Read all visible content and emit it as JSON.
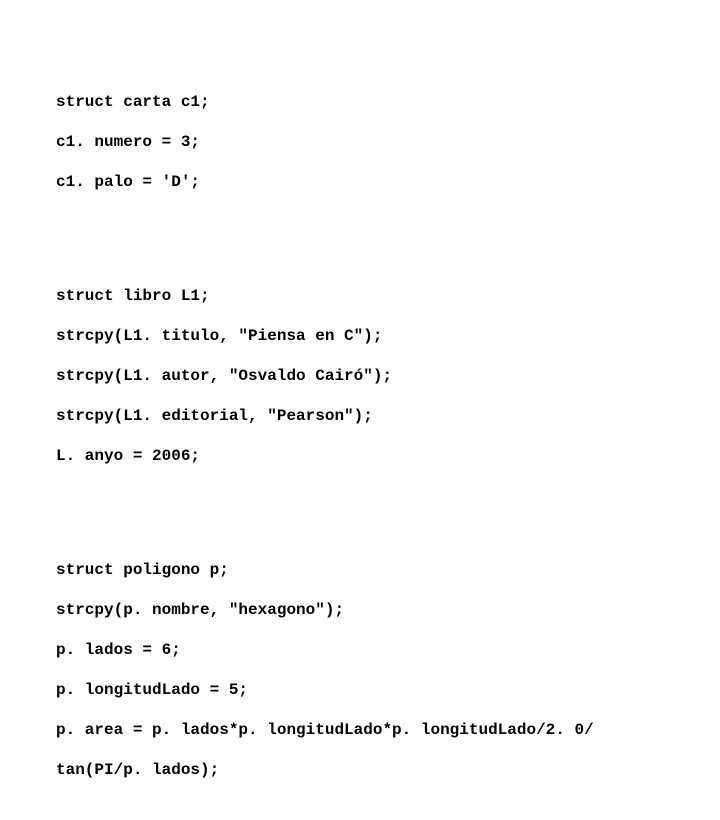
{
  "block1": {
    "l1": "struct carta c1;",
    "l2": "c1. numero = 3;",
    "l3": "c1. palo = 'D';"
  },
  "block2": {
    "l1": "struct libro L1;",
    "l2": "strcpy(L1. titulo, \"Piensa en C\");",
    "l3": "strcpy(L1. autor, \"Osvaldo Cairó\");",
    "l4": "strcpy(L1. editorial, \"Pearson\");",
    "l5": "L. anyo = 2006;"
  },
  "block3": {
    "l1": "struct poligono p;",
    "l2": "strcpy(p. nombre, \"hexagono\");",
    "l3": "p. lados = 6;",
    "l4": "p. longitudLado = 5;",
    "l5": "p. area = p. lados*p. longitudLado*p. longitudLado/2. 0/",
    "l6": "tan(PI/p. lados);"
  }
}
